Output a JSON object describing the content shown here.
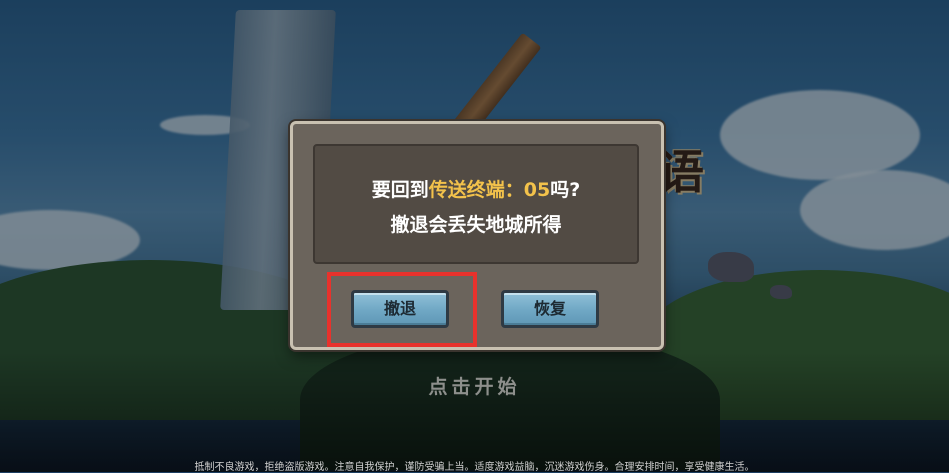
{
  "dialog": {
    "line1_prefix": "要回到",
    "line1_highlight": "传送终端：05",
    "line1_suffix": "吗?",
    "line2": "撤退会丢失地城所得",
    "retreat_label": "撤退",
    "resume_label": "恢复"
  },
  "screen": {
    "start_prompt": "点击开始",
    "logo_visible_char": "语",
    "health_notice": "抵制不良游戏，拒绝盗版游戏。注意自我保护，谨防受骗上当。适度游戏益脑，沉迷游戏伤身。合理安排时间，享受健康生活。"
  },
  "colors": {
    "highlight_text": "#f3c24b",
    "button_fill": "#6fa7c4",
    "dialog_frame": "#6b645c",
    "annotation_box": "#e8322c"
  }
}
